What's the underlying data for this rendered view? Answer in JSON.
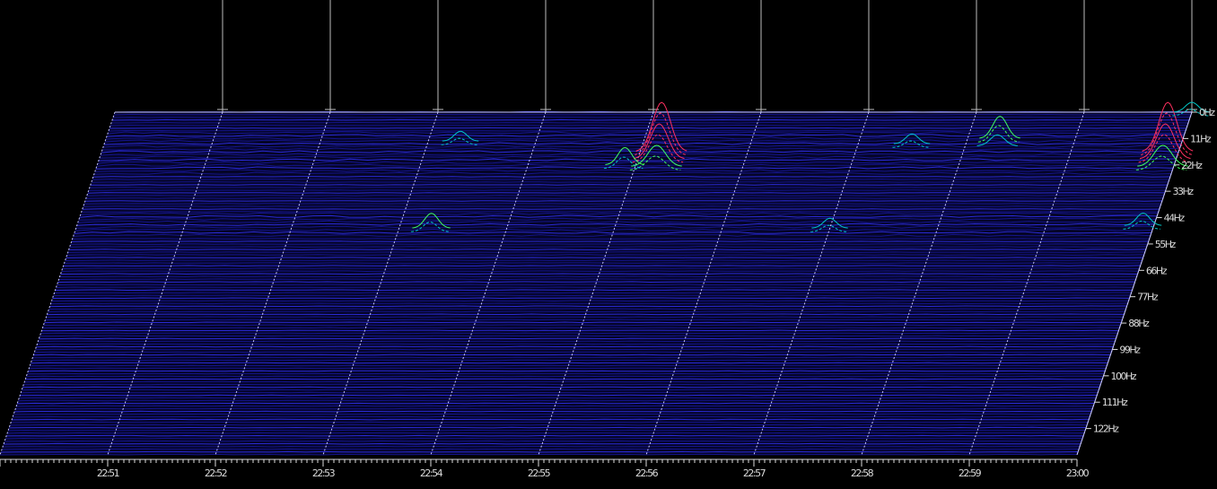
{
  "chart_data": {
    "type": "heatmap",
    "time_ticks": [
      "22:51",
      "22:52",
      "22:53",
      "22:54",
      "22:55",
      "22:56",
      "22:57",
      "22:58",
      "22:59",
      "23:00"
    ],
    "frequency_ticks": [
      "0Hz",
      "11Hz",
      "22Hz",
      "33Hz",
      "44Hz",
      "55Hz",
      "66Hz",
      "77Hz",
      "88Hz",
      "99Hz",
      "100Hz",
      "111Hz",
      "122Hz"
    ],
    "frequency_range_hz": [
      0,
      130
    ],
    "time_range": [
      "22:50",
      "23:00"
    ],
    "grid": true,
    "colors": {
      "background": "#000000",
      "trace": "#2a2ad4",
      "trace_faint": "#14148a",
      "grid": "#c8c8ff",
      "label": "#dcdcdc",
      "peak_low": "#00c8c8",
      "peak_mid": "#40ff60",
      "peak_high": "#ff3060"
    },
    "peaks": [
      {
        "time": "22:55.2",
        "freq_hz": 15,
        "amplitude": 1.0
      },
      {
        "time": "22:54.9",
        "freq_hz": 20,
        "amplitude": 0.35
      },
      {
        "time": "22:58.3",
        "freq_hz": 10,
        "amplitude": 0.45
      },
      {
        "time": "22:57.5",
        "freq_hz": 12,
        "amplitude": 0.2
      },
      {
        "time": "22:53.3",
        "freq_hz": 11,
        "amplitude": 0.2
      },
      {
        "time": "22:53.3",
        "freq_hz": 44,
        "amplitude": 0.3
      },
      {
        "time": "22:57.0",
        "freq_hz": 44,
        "amplitude": 0.2
      },
      {
        "time": "22:59.9",
        "freq_hz": 15,
        "amplitude": 1.0
      },
      {
        "time": "22:59.9",
        "freq_hz": 43,
        "amplitude": 0.25
      },
      {
        "time": "23:00.0",
        "freq_hz": 0,
        "amplitude": 0.2
      }
    ]
  }
}
